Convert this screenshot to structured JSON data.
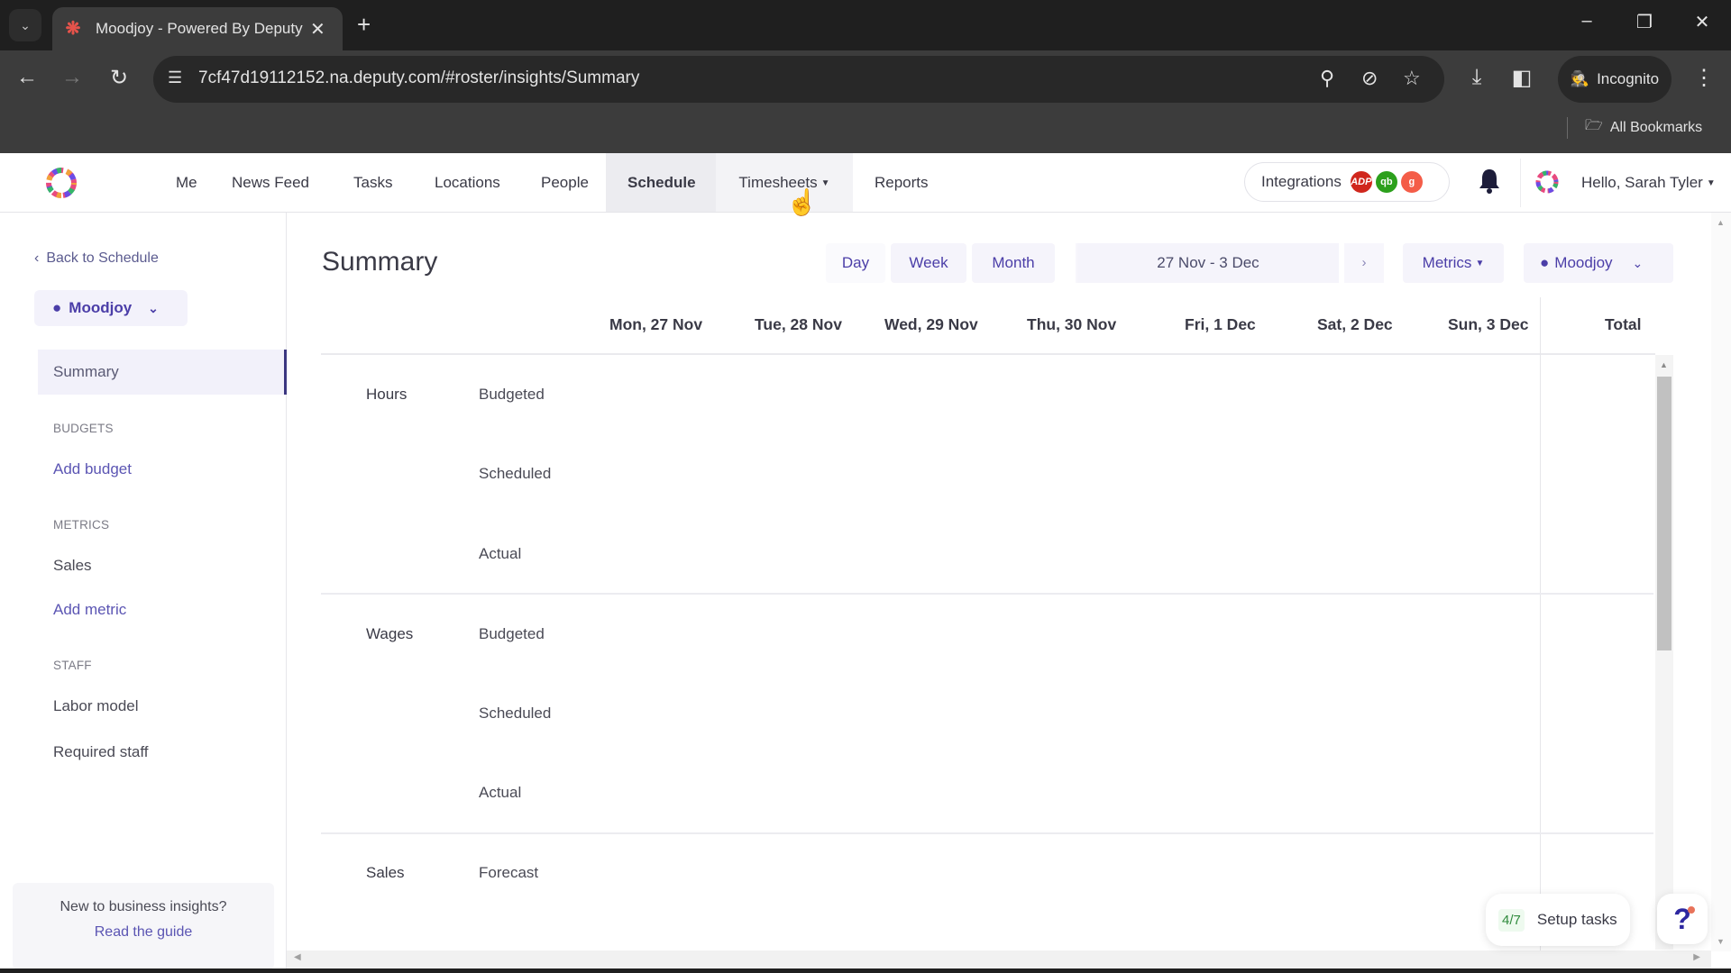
{
  "browser": {
    "tab_title": "Moodjoy - Powered By Deputy",
    "url": "7cf47d19112152.na.deputy.com/#roster/insights/Summary",
    "incognito_label": "Incognito",
    "all_bookmarks_label": "All Bookmarks"
  },
  "nav": {
    "items": [
      {
        "label": "Me"
      },
      {
        "label": "News Feed"
      },
      {
        "label": "Tasks"
      },
      {
        "label": "Locations"
      },
      {
        "label": "People"
      },
      {
        "label": "Schedule",
        "active": true
      },
      {
        "label": "Timesheets",
        "has_dropdown": true
      },
      {
        "label": "Reports"
      }
    ],
    "integrations_label": "Integrations",
    "integration_badges": [
      {
        "name": "adp",
        "text": "ADP",
        "color": "#d0271d"
      },
      {
        "name": "quickbooks",
        "text": "qb",
        "color": "#2ca01c"
      },
      {
        "name": "gusto",
        "text": "g",
        "color": "#f45d48"
      }
    ],
    "user_greeting": "Hello, Sarah Tyler"
  },
  "sidebar": {
    "back_label": "Back to Schedule",
    "location": "Moodjoy",
    "active_item": "Summary",
    "sections": [
      {
        "title": "BUDGETS",
        "items": [
          {
            "label": "Add budget",
            "type": "link"
          }
        ]
      },
      {
        "title": "METRICS",
        "items": [
          {
            "label": "Sales",
            "type": "item"
          },
          {
            "label": "Add metric",
            "type": "link"
          }
        ]
      },
      {
        "title": "STAFF",
        "items": [
          {
            "label": "Labor model",
            "type": "item"
          },
          {
            "label": "Required staff",
            "type": "item"
          }
        ]
      }
    ],
    "guide_question": "New to business insights?",
    "guide_link": "Read the guide"
  },
  "main": {
    "title": "Summary",
    "view_buttons": [
      "Day",
      "Week",
      "Month"
    ],
    "date_range": "27 Nov - 3 Dec",
    "metrics_label": "Metrics",
    "location_label": "Moodjoy",
    "columns": [
      "Mon, 27 Nov",
      "Tue, 28 Nov",
      "Wed, 29 Nov",
      "Thu, 30 Nov",
      "Fri, 1 Dec",
      "Sat, 2 Dec",
      "Sun, 3 Dec",
      "Total"
    ],
    "groups": [
      {
        "name": "Hours",
        "rows": [
          "Budgeted",
          "Scheduled",
          "Actual"
        ]
      },
      {
        "name": "Wages",
        "rows": [
          "Budgeted",
          "Scheduled",
          "Actual"
        ]
      },
      {
        "name": "Sales",
        "rows": [
          "Forecast"
        ]
      }
    ]
  },
  "floating": {
    "setup_progress": "4/7",
    "setup_label": "Setup tasks",
    "help_label": "?"
  }
}
